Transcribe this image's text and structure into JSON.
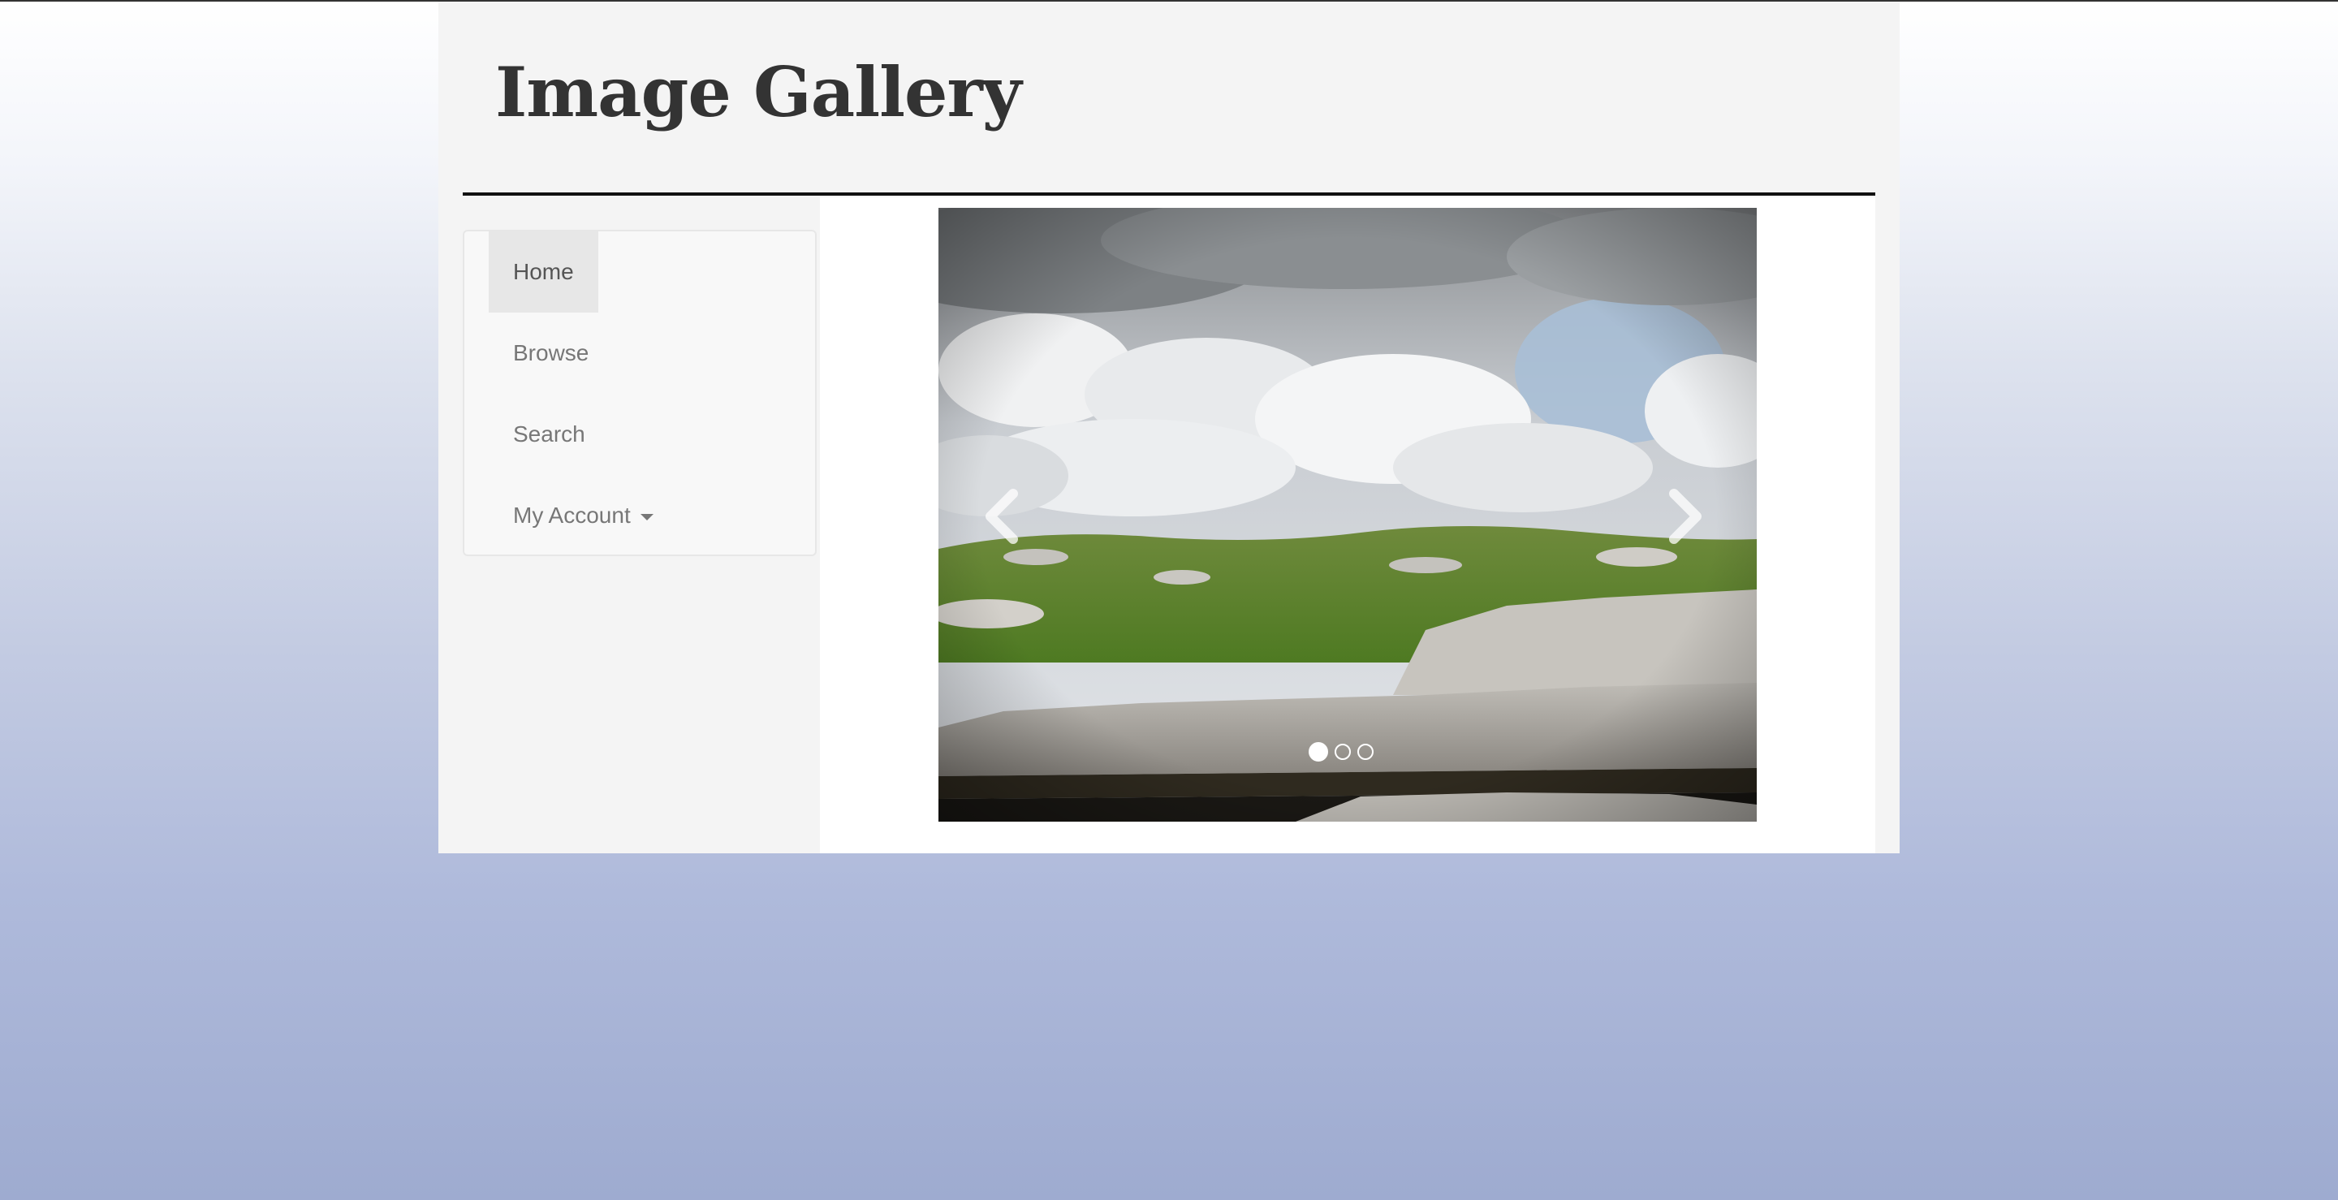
{
  "site": {
    "title": "Image Gallery"
  },
  "nav": {
    "items": [
      {
        "label": "Home",
        "active": true
      },
      {
        "label": "Browse",
        "active": false
      },
      {
        "label": "Search",
        "active": false
      },
      {
        "label": "My Account",
        "active": false,
        "has_dropdown": true
      }
    ]
  },
  "carousel": {
    "slide_count": 3,
    "active_index": 0,
    "prev_icon": "chevron-left-icon",
    "next_icon": "chevron-right-icon"
  },
  "colors": {
    "title": "#333333",
    "nav_text": "#777777",
    "nav_active_bg": "#e7e7e7",
    "container_bg": "#f4f4f4"
  }
}
